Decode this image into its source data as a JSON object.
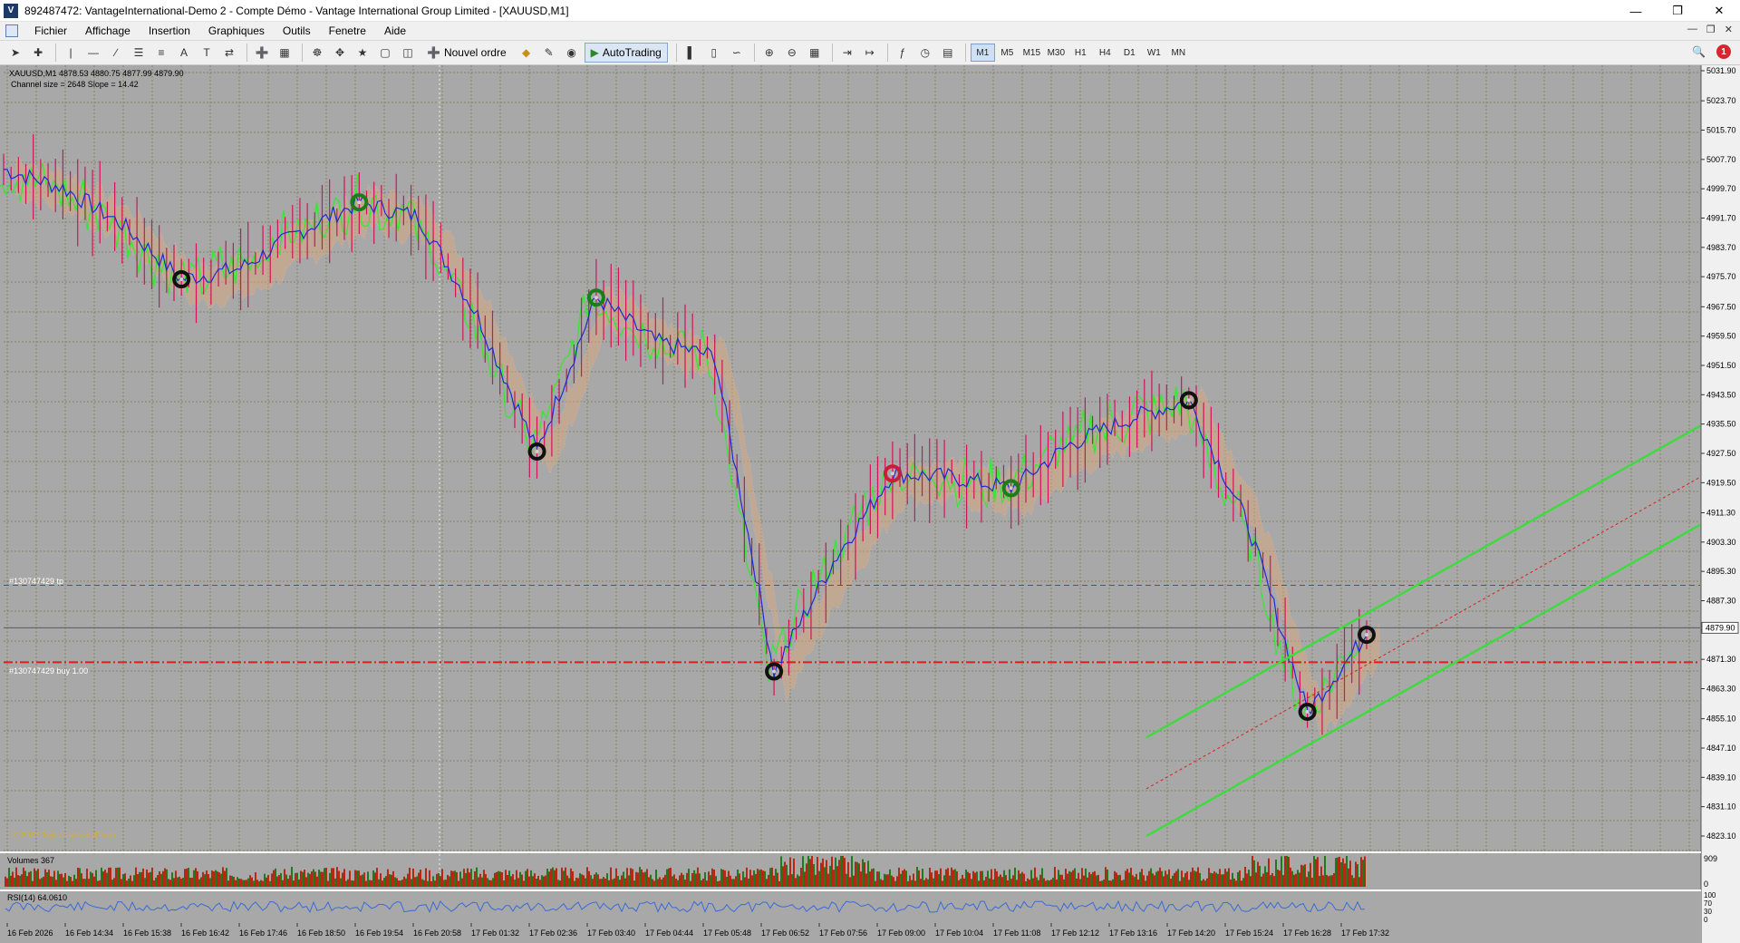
{
  "window": {
    "title": "892487472: VantageInternational-Demo 2 - Compte Démo - Vantage International Group Limited - [XAUUSD,M1]",
    "icon_label": "V"
  },
  "menu": [
    "Fichier",
    "Affichage",
    "Insertion",
    "Graphiques",
    "Outils",
    "Fenetre",
    "Aide"
  ],
  "toolbar": {
    "new_order_label": "Nouvel ordre",
    "autotrading_label": "AutoTrading",
    "timeframes": [
      "M1",
      "M5",
      "M15",
      "M30",
      "H1",
      "H4",
      "D1",
      "W1",
      "MN"
    ],
    "active_timeframe": "M1",
    "alert_count": "1"
  },
  "chart": {
    "symbol_header": "XAUUSD,M1  4878.53 4880.75 4877.99 4879.90",
    "channel_info": "Channel size = 2648 Slope = 14.42",
    "order_tp_label": "#130747429 tp",
    "order_buy_label": "#130747429 buy 1.00",
    "watermark": "© 2023 TopLessons.in/Forex",
    "current_price": "4879.90",
    "price_ticks": [
      "5031.90",
      "5023.70",
      "5015.70",
      "5007.70",
      "4999.70",
      "4991.70",
      "4983.70",
      "4975.70",
      "4967.50",
      "4959.50",
      "4951.50",
      "4943.50",
      "4935.50",
      "4927.50",
      "4919.50",
      "4911.30",
      "4903.30",
      "4895.30",
      "4887.30",
      "4879.30",
      "4871.30",
      "4863.30",
      "4855.10",
      "4847.10",
      "4839.10",
      "4831.10",
      "4823.10"
    ],
    "time_ticks": [
      "16 Feb 2026",
      "16 Feb 14:34",
      "16 Feb 15:38",
      "16 Feb 16:42",
      "16 Feb 17:46",
      "16 Feb 18:50",
      "16 Feb 19:54",
      "16 Feb 20:58",
      "17 Feb 01:32",
      "17 Feb 02:36",
      "17 Feb 03:40",
      "17 Feb 04:44",
      "17 Feb 05:48",
      "17 Feb 06:52",
      "17 Feb 07:56",
      "17 Feb 09:00",
      "17 Feb 10:04",
      "17 Feb 11:08",
      "17 Feb 12:12",
      "17 Feb 13:16",
      "17 Feb 14:20",
      "17 Feb 15:24",
      "17 Feb 16:28",
      "17 Feb 17:32"
    ],
    "volume_label": "Volumes 367",
    "volume_scale": [
      "909",
      "0"
    ],
    "rsi_label": "RSI(14) 64.0610",
    "rsi_scale": [
      "100",
      "70",
      "30",
      "0"
    ]
  },
  "colors": {
    "chart_bg": "#a8a8a8",
    "grid": "#7a7a52",
    "price_line": "#1d2bd0",
    "candles": "#d0135a",
    "fast_line": "#39e536",
    "channel": "#3cdc3c",
    "order_line": "#d8201a",
    "cloud": "#e0a878",
    "marker_black": "#111111",
    "marker_green": "#1a7f1a",
    "marker_red": "#c81e3c",
    "rsi_line": "#3a6bd6",
    "volume_up": "#1d7a1d",
    "volume_down": "#b22a14"
  },
  "chart_data": {
    "type": "line",
    "title": "XAUUSD,M1",
    "xlabel": "",
    "ylabel": "",
    "ylim": [
      4823.1,
      5031.9
    ],
    "x": [
      "16 Feb 2026",
      "16 Feb 14:34",
      "16 Feb 15:38",
      "16 Feb 16:42",
      "16 Feb 17:46",
      "16 Feb 18:50",
      "16 Feb 19:54",
      "16 Feb 20:58",
      "17 Feb 01:32",
      "17 Feb 02:36",
      "17 Feb 03:40",
      "17 Feb 04:44",
      "17 Feb 05:48",
      "17 Feb 06:52",
      "17 Feb 07:56",
      "17 Feb 09:00",
      "17 Feb 10:04",
      "17 Feb 11:08",
      "17 Feb 12:12",
      "17 Feb 13:16",
      "17 Feb 14:20",
      "17 Feb 15:24",
      "17 Feb 16:28",
      "17 Feb 17:32"
    ],
    "series": [
      {
        "name": "XAUUSD",
        "values": [
          5005,
          5000,
          4990,
          4975,
          4978,
          4988,
          4996,
          4992,
          4965,
          4928,
          4970,
          4958,
          4954,
          4868,
          4898,
          4922,
          4921,
          4918,
          4930,
          4937,
          4942,
          4908,
          4857,
          4878
        ]
      }
    ],
    "grid": true
  }
}
